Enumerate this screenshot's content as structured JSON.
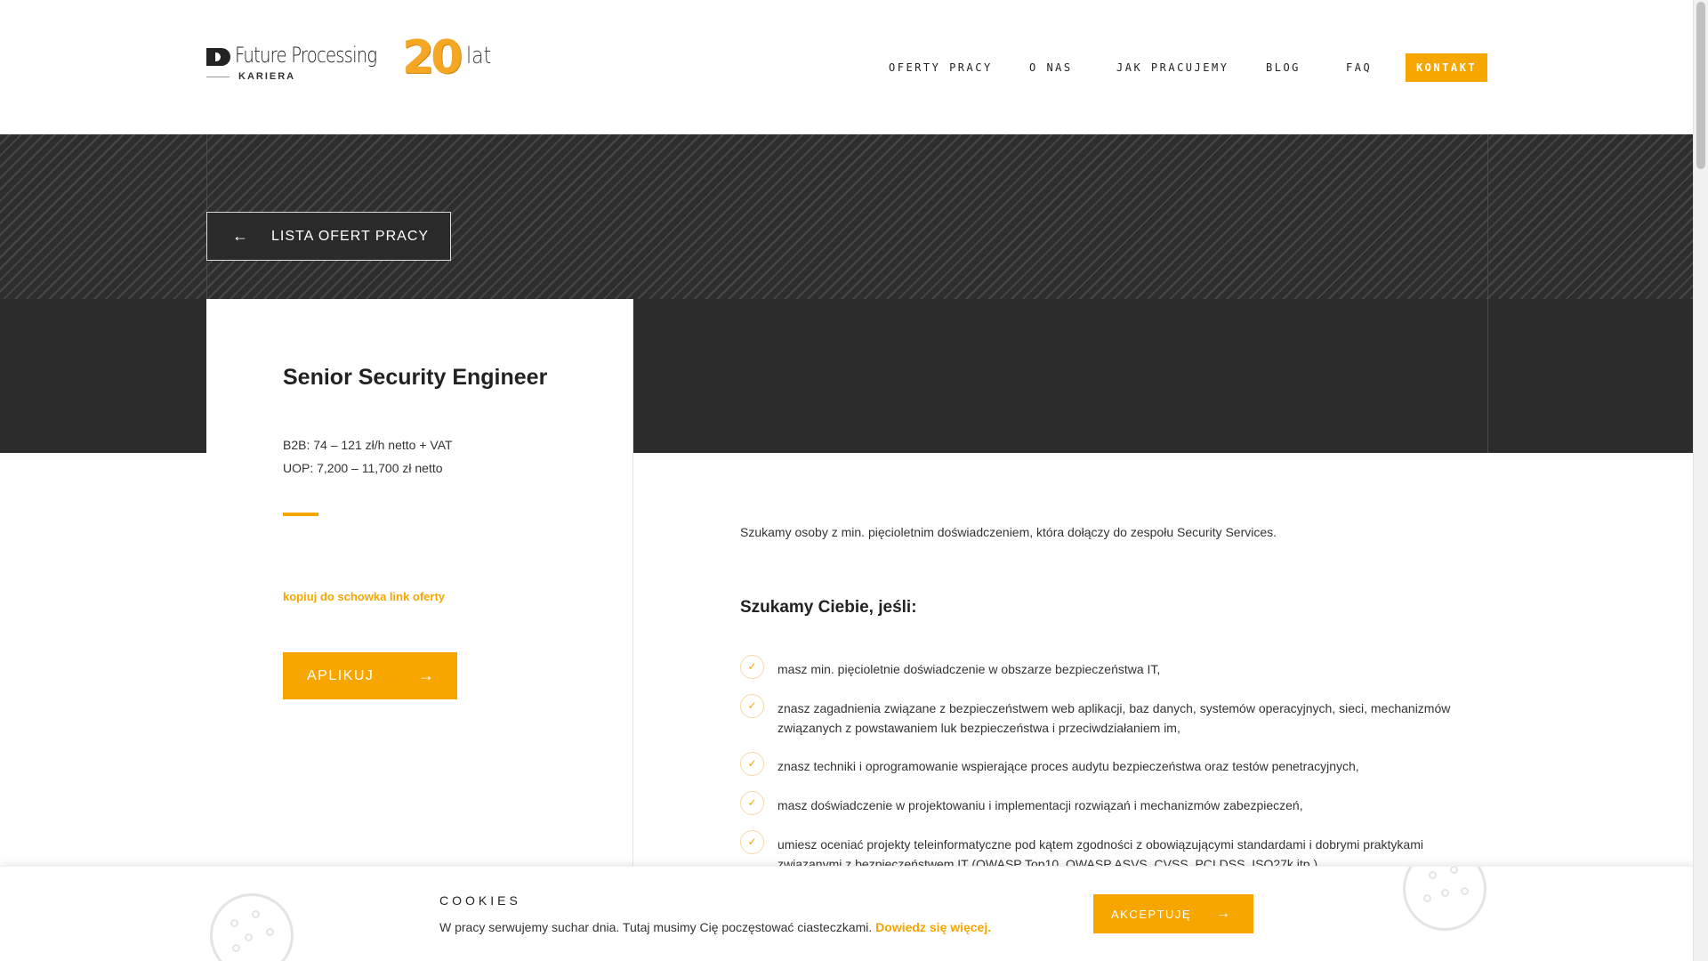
{
  "header": {
    "logo_name": "Future Processing",
    "logo_sub": "KARIERA",
    "anniversary_number": "20",
    "anniversary_unit": "lat",
    "nav": [
      {
        "label": "OFERTY PRACY"
      },
      {
        "label": "O NAS"
      },
      {
        "label": "JAK PRACUJEMY"
      },
      {
        "label": "BLOG"
      },
      {
        "label": "FAQ"
      }
    ],
    "contact_label": "KONTAKT"
  },
  "hero": {
    "back_label": "LISTA OFERT PRACY"
  },
  "job": {
    "title": "Senior Security Engineer",
    "salary_b2b": "B2B: 74 – 121 zł/h netto + VAT",
    "salary_uop": "UOP: 7,200 – 11,700 zł netto",
    "copy_link": "kopiuj do schowka link oferty",
    "apply_label": "APLIKUJ"
  },
  "content": {
    "intro": "Szukamy osoby z min. pięcioletnim doświadczeniem, która dołączy do zespołu Security Services.",
    "section_title": "Szukamy Ciebie, jeśli:",
    "requirements": [
      "masz min. pięcioletnie doświadczenie w obszarze bezpieczeństwa IT,",
      "znasz zagadnienia związane z bezpieczeństwem web aplikacji, baz danych, systemów operacyjnych, sieci, mechanizmów związanych z powstawaniem luk bezpieczeństwa i przeciwdziałaniem im,",
      "znasz techniki i oprogramowanie wspierające proces audytu bezpieczeństwa oraz testów penetracyjnych,",
      "masz doświadczenie w projektowaniu i implementacji rozwiązań i mechanizmów zabezpieczeń,",
      "umiesz oceniać projekty teleinformatyczne pod kątem zgodności z obowiązującymi standardami i dobrymi praktykami związanymi z bezpieczeństwem IT (OWASP Top10, OWASP ASVS, CVSS, PCI DSS, ISO27k itp.),"
    ]
  },
  "cookies": {
    "title": "COOKIES",
    "text": "W pracy serwujemy suchar dnia. Tutaj musimy Cię poczęstować ciasteczkami.",
    "more_link": "Dowiedz się więcej",
    "period": ".",
    "accept_label": "AKCEPTUJĘ"
  },
  "colors": {
    "accent": "#f7a600",
    "hero_dark": "#2c2c2c"
  },
  "icons": [
    "arrow-left-icon",
    "arrow-right-icon",
    "check-icon",
    "cookie-icon"
  ]
}
